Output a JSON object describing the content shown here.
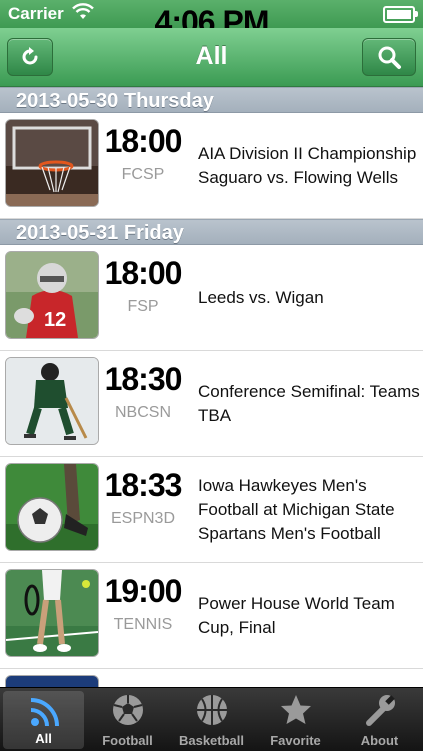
{
  "status": {
    "carrier": "Carrier",
    "time": "4:06 PM"
  },
  "nav": {
    "title": "All"
  },
  "sections": [
    {
      "header": "2013-05-30 Thursday",
      "rows": [
        {
          "time": "18:00",
          "channel": "FCSP",
          "title": "AIA Division II Championship Saguaro vs. Flowing Wells"
        }
      ]
    },
    {
      "header": "2013-05-31 Friday",
      "rows": [
        {
          "time": "18:00",
          "channel": "FSP",
          "title": "Leeds vs. Wigan"
        },
        {
          "time": "18:30",
          "channel": "NBCSN",
          "title": "Conference Semifinal: Teams TBA"
        },
        {
          "time": "18:33",
          "channel": "ESPN3D",
          "title": "Iowa Hawkeyes Men's Football at Michigan State Spartans Men's Football"
        },
        {
          "time": "19:00",
          "channel": "TENNIS",
          "title": "Power House World Team Cup, Final"
        }
      ]
    }
  ],
  "tabs": [
    {
      "label": "All",
      "icon": "feed-icon"
    },
    {
      "label": "Football",
      "icon": "soccer-ball-icon"
    },
    {
      "label": "Basketball",
      "icon": "basketball-icon"
    },
    {
      "label": "Favorite",
      "icon": "star-icon"
    },
    {
      "label": "About",
      "icon": "wrench-icon"
    }
  ],
  "colors": {
    "nav_green": "#3b9b53",
    "section_gray": "#a4b0bc",
    "tab_bar": "#1e1e1e"
  }
}
